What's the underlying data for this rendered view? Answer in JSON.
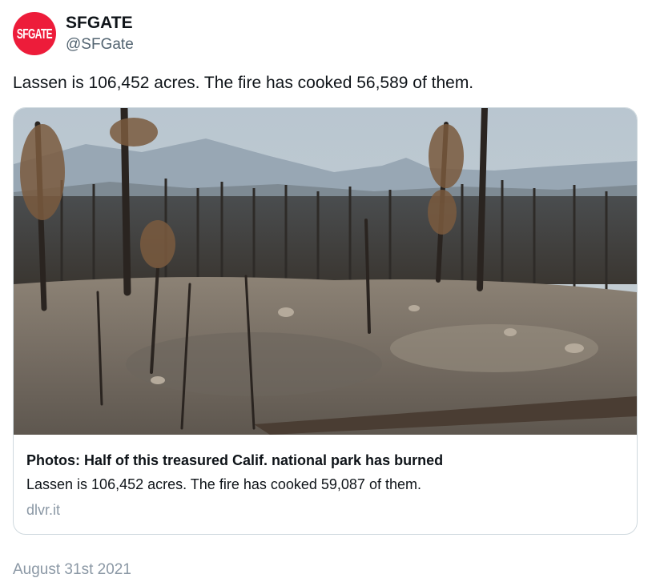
{
  "author": {
    "avatar_text": "SFGATE",
    "display_name": "SFGATE",
    "handle": "@SFGate"
  },
  "tweet": {
    "text": "Lassen is 106,452 acres. The fire has cooked 56,589 of them.",
    "timestamp": "August 31st 2021"
  },
  "card": {
    "title": "Photos: Half of this treasured Calif. national park has burned",
    "description": "Lassen is 106,452 acres. The fire has cooked 59,087 of them.",
    "domain": "dlvr.it"
  },
  "colors": {
    "brand": "#ed1c3a",
    "secondary_text": "#536471",
    "border": "#cfd9de"
  }
}
